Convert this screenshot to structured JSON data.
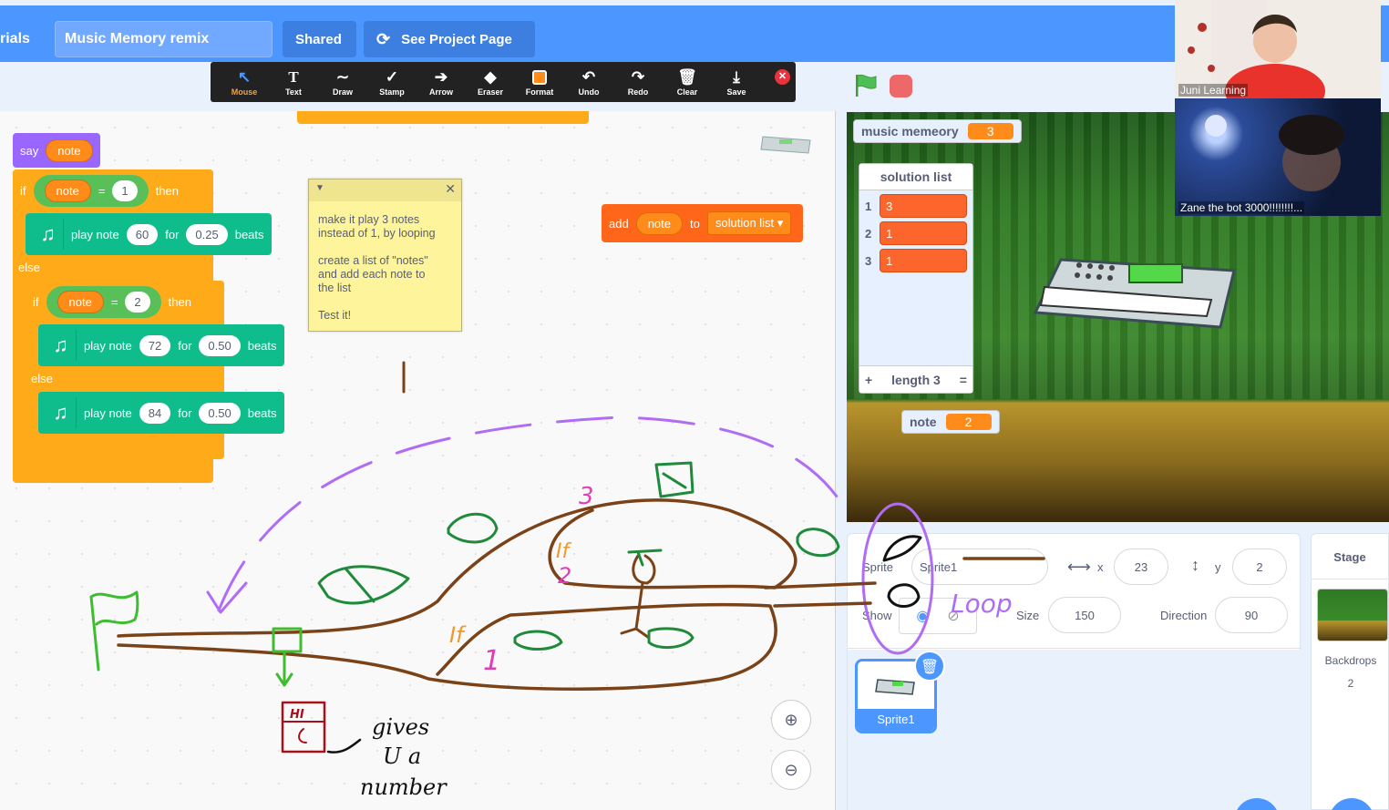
{
  "menubar": {
    "fragment": "rials",
    "project_title": "Music Memory remix",
    "shared_label": "Shared",
    "project_page_label": "See Project Page"
  },
  "toolbar": {
    "tools": [
      "Mouse",
      "Text",
      "Draw",
      "Stamp",
      "Arrow",
      "Eraser",
      "Format",
      "Undo",
      "Redo",
      "Clear",
      "Save"
    ],
    "active_tool": "Mouse",
    "format_color": "#ff8c1a"
  },
  "script": {
    "say_label": "say",
    "note_reporter": "note",
    "if_label": "if",
    "then_label": "then",
    "else_label": "else",
    "equals": "=",
    "if1_value": "1",
    "if2_value": "2",
    "play_note_label": "play note",
    "for_label": "for",
    "beats_label": "beats",
    "play1_note": "60",
    "play1_beats": "0.25",
    "play2_note": "72",
    "play2_beats": "0.50",
    "play3_note": "84",
    "play3_beats": "0.50",
    "add_label": "add",
    "to_label": "to",
    "list_dropdown": "solution list"
  },
  "comment": {
    "text": "make it play 3 notes\ninstead of 1, by looping\n\ncreate a list of \"notes\"\nand add each note to\nthe list\n\nTest it!"
  },
  "drawing": {
    "labels": [
      "3",
      "If",
      "2",
      "If",
      "1",
      "Loop"
    ],
    "annotation": "gives\nU a\nnumber",
    "box_text": "HI"
  },
  "stage": {
    "var_monitor_label": "music memeory",
    "var_monitor_value": "3",
    "list_title": "solution list",
    "list_items": [
      "3",
      "1",
      "1"
    ],
    "list_length_label": "length 3",
    "list_add": "+",
    "list_resize": "=",
    "note_monitor_label": "note",
    "note_monitor_value": "2"
  },
  "video": {
    "tile1_label": "Juni Learning",
    "tile2_label": "Zane the bot 3000!!!!!!!!..."
  },
  "sprite_info": {
    "sprite_label": "Sprite",
    "sprite_name": "Sprite1",
    "x_label": "x",
    "x_value": "23",
    "y_label": "y",
    "y_value": "2",
    "show_label": "Show",
    "size_label": "Size",
    "size_value": "150",
    "direction_label": "Direction",
    "direction_value": "90",
    "thumb_name": "Sprite1"
  },
  "stage_panel": {
    "title": "Stage",
    "backdrops_label": "Backdrops",
    "backdrops_count": "2"
  }
}
